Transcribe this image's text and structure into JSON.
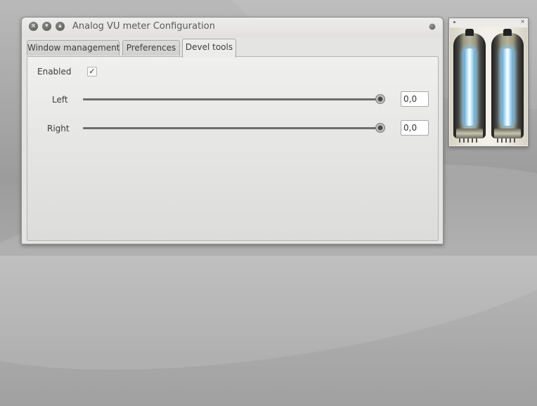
{
  "window": {
    "title": "Analog VU meter Configuration",
    "controls": [
      "close-icon",
      "minimize-icon",
      "maximize-icon"
    ]
  },
  "tabs": [
    {
      "label": "Window management",
      "active": false
    },
    {
      "label": "Preferences",
      "active": false
    },
    {
      "label": "Devel tools",
      "active": true
    }
  ],
  "devel": {
    "enabled_label": "Enabled",
    "enabled": true,
    "check_glyph": "✓",
    "left_label": "Left",
    "left_value": "0,0",
    "left_level": 1.0,
    "right_label": "Right",
    "right_value": "0,0",
    "right_level": 1.0
  },
  "preview": {
    "close_glyph": "×"
  },
  "colors": {
    "glow": "#9fd8ff",
    "window_bg": "#e4e4e2"
  }
}
